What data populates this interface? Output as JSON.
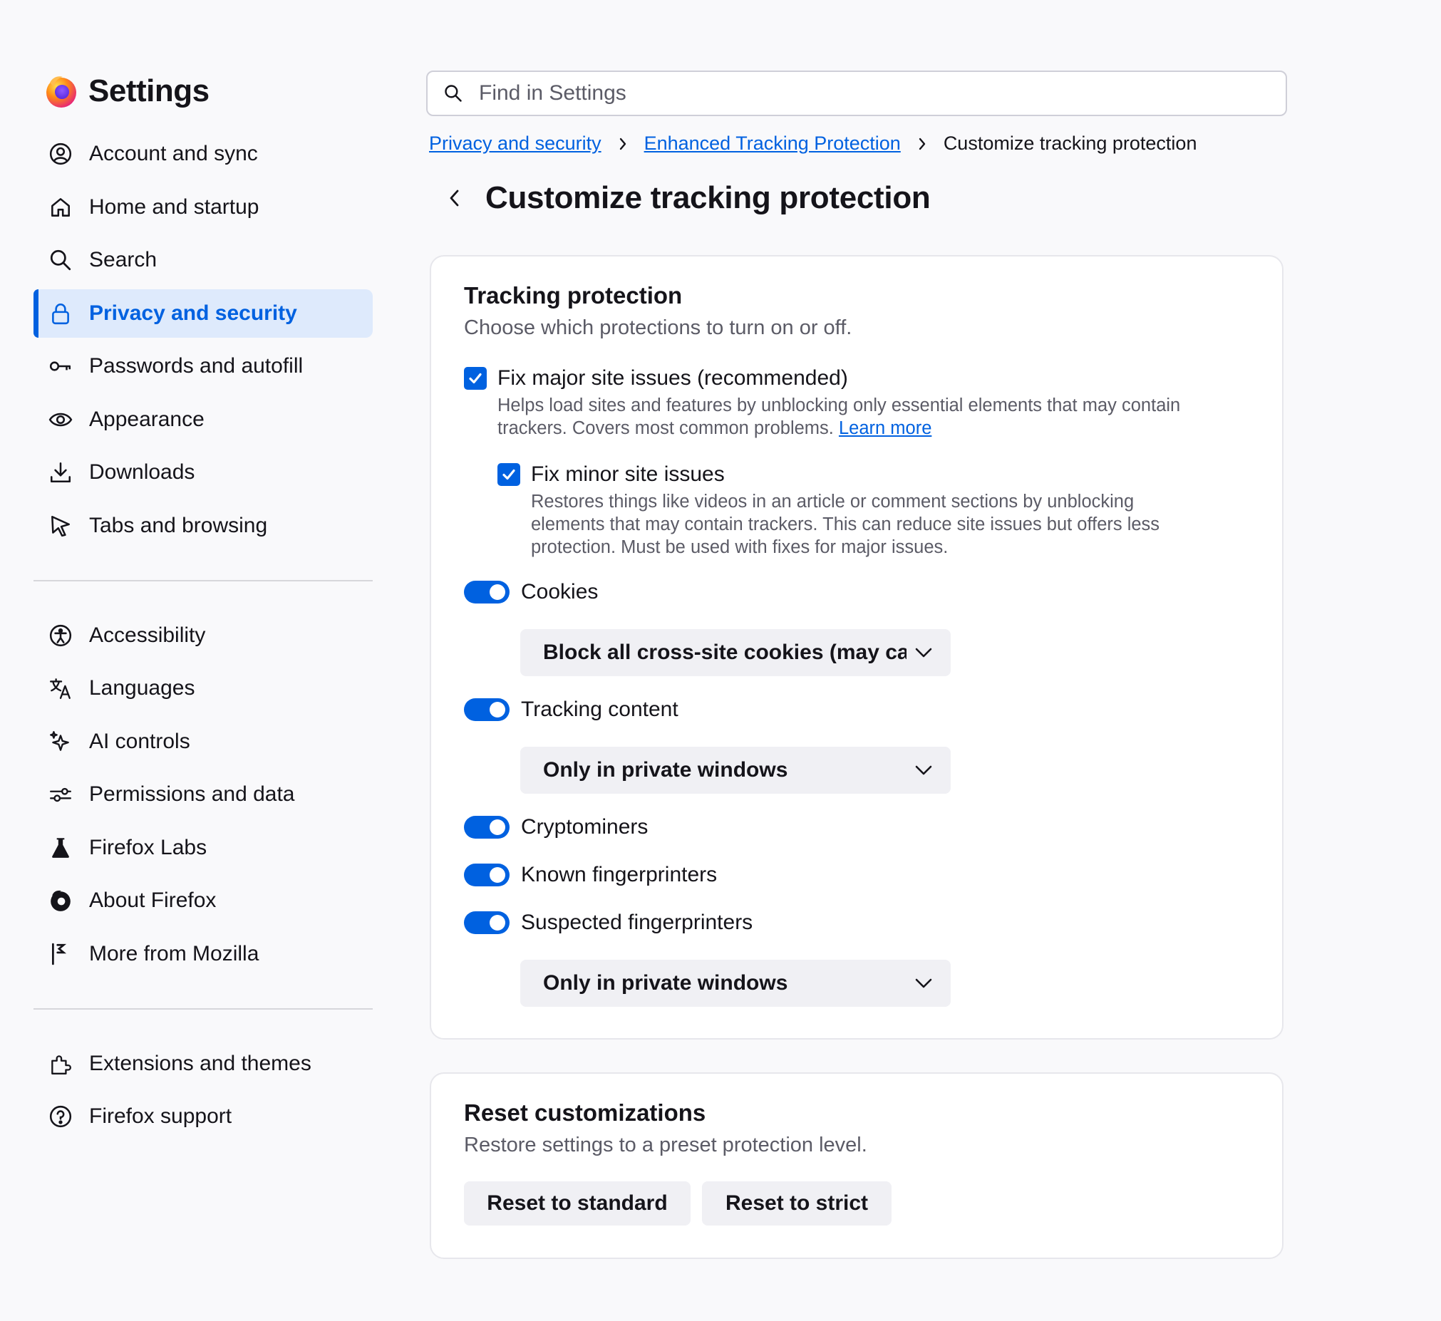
{
  "app": {
    "title": "Settings"
  },
  "search": {
    "placeholder": "Find in Settings"
  },
  "sidebar": {
    "group1": [
      {
        "label": "Account and sync",
        "icon": "account-icon"
      },
      {
        "label": "Home and startup",
        "icon": "home-icon"
      },
      {
        "label": "Search",
        "icon": "search-icon"
      },
      {
        "label": "Privacy and security",
        "icon": "lock-icon",
        "active": true
      },
      {
        "label": "Passwords and autofill",
        "icon": "key-icon"
      },
      {
        "label": "Appearance",
        "icon": "eye-icon"
      },
      {
        "label": "Downloads",
        "icon": "download-icon"
      },
      {
        "label": "Tabs and browsing",
        "icon": "cursor-icon"
      }
    ],
    "group2": [
      {
        "label": "Accessibility",
        "icon": "accessibility-icon"
      },
      {
        "label": "Languages",
        "icon": "translate-icon"
      },
      {
        "label": "AI controls",
        "icon": "sparkle-icon"
      },
      {
        "label": "Permissions and data",
        "icon": "permissions-icon"
      },
      {
        "label": "Firefox Labs",
        "icon": "flask-icon"
      },
      {
        "label": "About Firefox",
        "icon": "firefox-icon"
      },
      {
        "label": "More from Mozilla",
        "icon": "mozilla-icon"
      }
    ],
    "group3": [
      {
        "label": "Extensions and themes",
        "icon": "puzzle-icon"
      },
      {
        "label": "Firefox support",
        "icon": "help-icon"
      }
    ]
  },
  "breadcrumb": {
    "link1": "Privacy and security",
    "link2": "Enhanced Tracking Protection",
    "current": "Customize tracking protection"
  },
  "page": {
    "title": "Customize tracking protection"
  },
  "tracking": {
    "title": "Tracking protection",
    "subtitle": "Choose which protections to turn on or off.",
    "major": {
      "label": "Fix major site issues (recommended)",
      "checked": true,
      "desc_line1": "Helps load sites and features by unblocking only essential elements that may contain",
      "desc_line2": "trackers. Covers most common problems.",
      "learn_more": "Learn more"
    },
    "minor": {
      "label": "Fix minor site issues",
      "checked": true,
      "desc_line1": "Restores things like videos in an article or comment sections by unblocking",
      "desc_line2": "elements that may contain trackers. This can reduce site issues but offers less",
      "desc_line3": "protection. Must be used with fixes for major issues."
    },
    "cookies": {
      "label": "Cookies",
      "on": true,
      "select": "Block all cross-site cookies (may cause websites to break)"
    },
    "tracking_content": {
      "label": "Tracking content",
      "on": true,
      "select": "Only in private windows"
    },
    "cryptominers": {
      "label": "Cryptominers",
      "on": true
    },
    "known_fp": {
      "label": "Known fingerprinters",
      "on": true
    },
    "suspected_fp": {
      "label": "Suspected fingerprinters",
      "on": true,
      "select": "Only in private windows"
    }
  },
  "reset": {
    "title": "Reset customizations",
    "subtitle": "Restore settings to a preset protection level.",
    "standard": "Reset to standard",
    "strict": "Reset to strict"
  },
  "colors": {
    "accent": "#0061e0",
    "active_bg": "#deeafc",
    "page_bg": "#f9f9fb",
    "muted_text": "#5b5b66"
  }
}
